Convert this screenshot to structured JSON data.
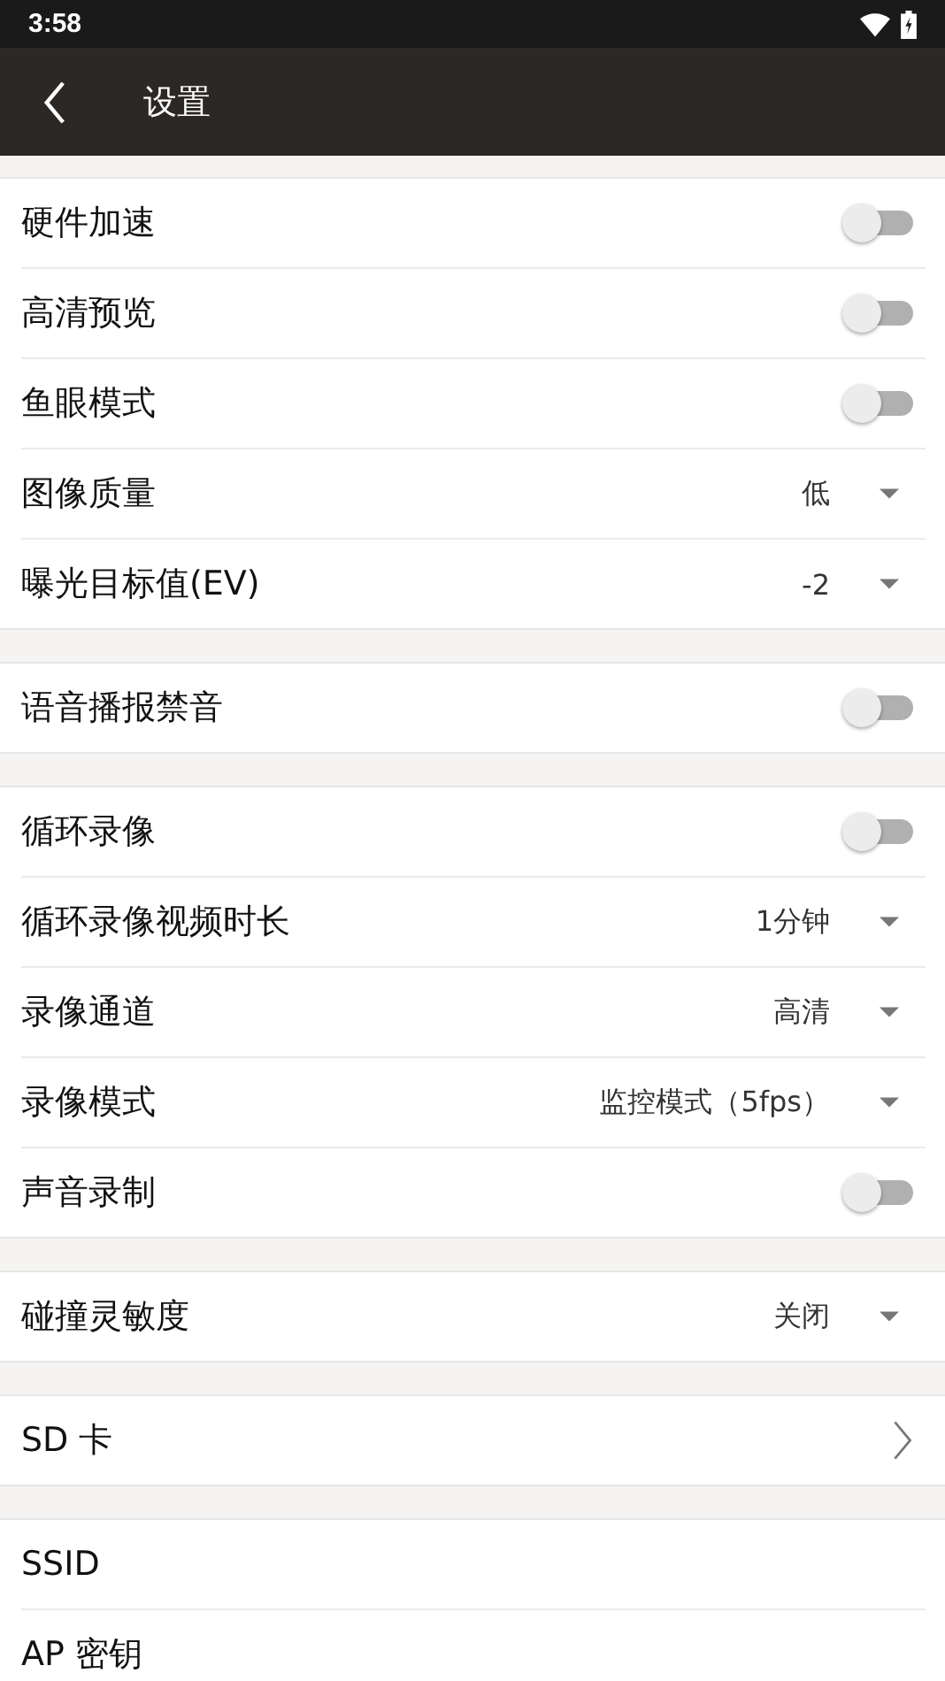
{
  "status_bar": {
    "time": "3:58"
  },
  "toolbar": {
    "title": "设置"
  },
  "groups": [
    {
      "items": [
        {
          "kind": "toggle",
          "label": "硬件加速",
          "on": false
        },
        {
          "kind": "toggle",
          "label": "高清预览",
          "on": false
        },
        {
          "kind": "toggle",
          "label": "鱼眼模式",
          "on": false
        },
        {
          "kind": "dropdown",
          "label": "图像质量",
          "value": "低"
        },
        {
          "kind": "dropdown",
          "label": "曝光目标值(EV)",
          "value": "-2"
        }
      ]
    },
    {
      "items": [
        {
          "kind": "toggle",
          "label": "语音播报禁音",
          "on": false
        }
      ]
    },
    {
      "items": [
        {
          "kind": "toggle",
          "label": "循环录像",
          "on": false
        },
        {
          "kind": "dropdown",
          "label": "循环录像视频时长",
          "value": "1分钟"
        },
        {
          "kind": "dropdown",
          "label": "录像通道",
          "value": "高清"
        },
        {
          "kind": "dropdown",
          "label": "录像模式",
          "value": "监控模式（5fps）"
        },
        {
          "kind": "toggle",
          "label": "声音录制",
          "on": false
        }
      ]
    },
    {
      "items": [
        {
          "kind": "dropdown",
          "label": "碰撞灵敏度",
          "value": "关闭"
        }
      ]
    },
    {
      "items": [
        {
          "kind": "link",
          "label": "SD 卡"
        }
      ]
    },
    {
      "items": [
        {
          "kind": "plain",
          "label": "SSID"
        },
        {
          "kind": "plain",
          "label": "AP 密钥"
        }
      ]
    }
  ]
}
